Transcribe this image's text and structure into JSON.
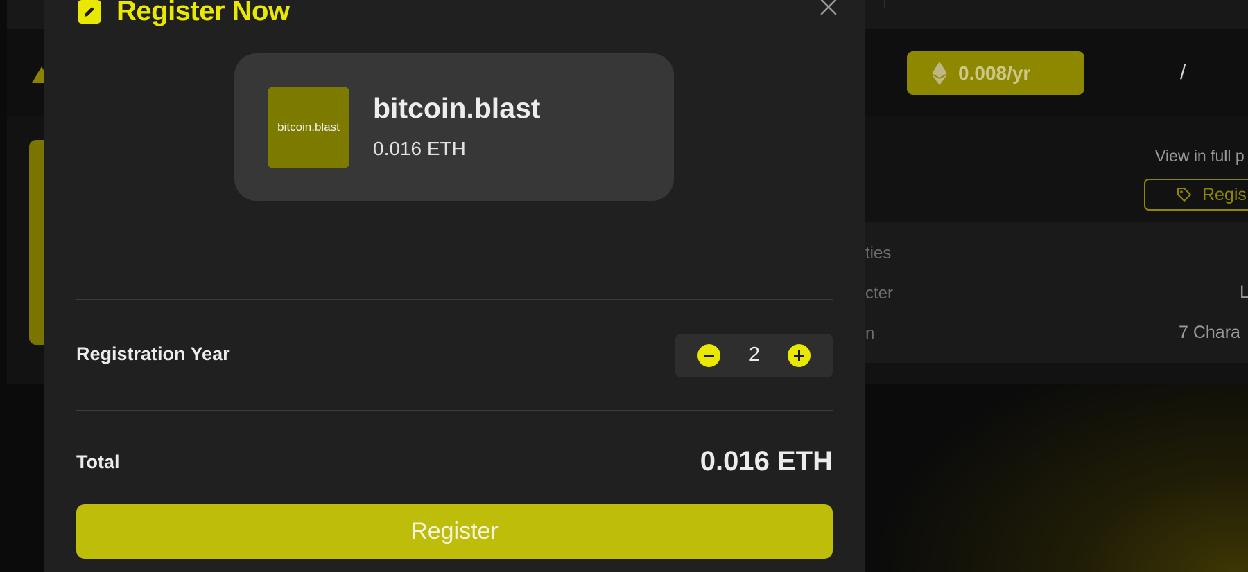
{
  "colors": {
    "accent": "#e9e800",
    "register_button": "#bebd0a",
    "modal_bg": "#202020",
    "card_bg": "#373737",
    "thumb_bg": "#7d7a00"
  },
  "background": {
    "price_pill": "0.008/yr",
    "slash": "/",
    "view_full": "View in full p",
    "register_outline": "Regis",
    "properties_label": "ties",
    "character_label": "cter",
    "length_label": "n",
    "character_value": "L",
    "length_value": "7 Chara"
  },
  "modal": {
    "title": "Register Now",
    "header_icon": "pencil-edit-icon",
    "close_icon": "close-icon",
    "card": {
      "thumb_text": "bitcoin.blast",
      "domain_name": "bitcoin.blast",
      "price": "0.016 ETH"
    },
    "registration_year": {
      "label": "Registration Year",
      "value": "2",
      "decrement_icon": "minus-icon",
      "increment_icon": "plus-icon"
    },
    "total": {
      "label": "Total",
      "value": "0.016 ETH"
    },
    "register_button": "Register"
  }
}
